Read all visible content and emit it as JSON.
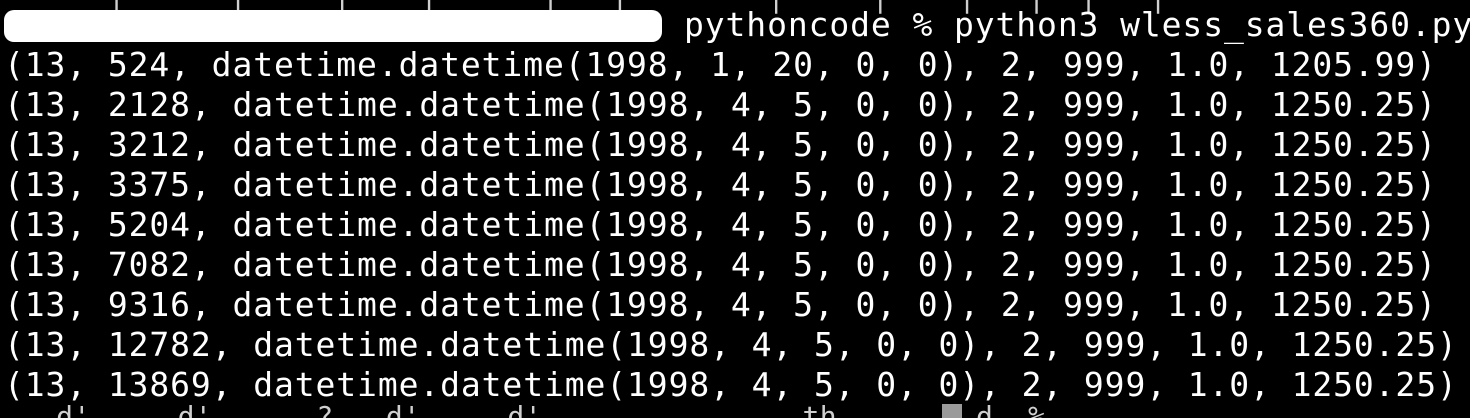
{
  "terminal": {
    "partial_top_line": "      |      |     |    |      |   |        |     |    |   |  |   |",
    "prompt_command": "pythoncode % python3 wless_sales360.py",
    "output_lines": [
      "(13, 524, datetime.datetime(1998, 1, 20, 0, 0), 2, 999, 1.0, 1205.99)",
      "(13, 2128, datetime.datetime(1998, 4, 5, 0, 0), 2, 999, 1.0, 1250.25)",
      "(13, 3212, datetime.datetime(1998, 4, 5, 0, 0), 2, 999, 1.0, 1250.25)",
      "(13, 3375, datetime.datetime(1998, 4, 5, 0, 0), 2, 999, 1.0, 1250.25)",
      "(13, 5204, datetime.datetime(1998, 4, 5, 0, 0), 2, 999, 1.0, 1250.25)",
      "(13, 7082, datetime.datetime(1998, 4, 5, 0, 0), 2, 999, 1.0, 1250.25)",
      "(13, 9316, datetime.datetime(1998, 4, 5, 0, 0), 2, 999, 1.0, 1250.25)",
      "(13, 12782, datetime.datetime(1998, 4, 5, 0, 0), 2, 999, 1.0, 1250.25)",
      "(13, 13869, datetime.datetime(1998, 4, 5, 0, 0), 2, 999, 1.0, 1250.25)"
    ],
    "partial_bottom_prompt": "  .d'    .d'      ?  .d'    .d'            .  th        d  %"
  }
}
